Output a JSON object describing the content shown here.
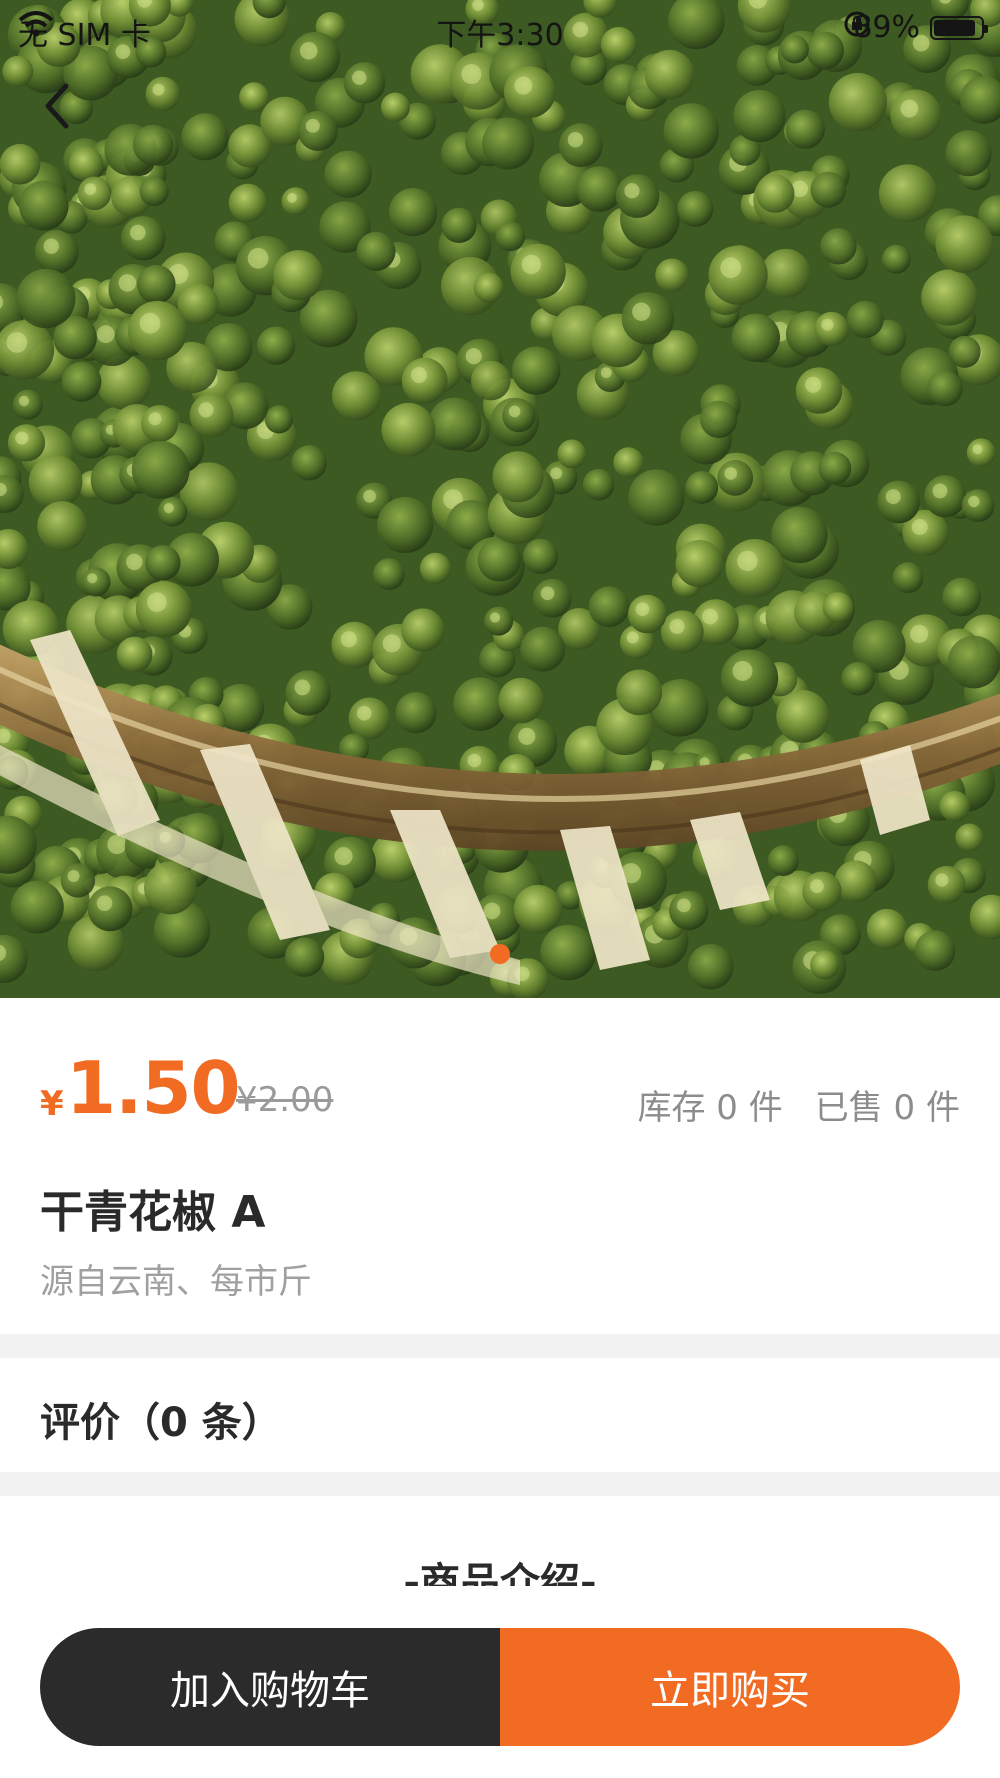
{
  "status_bar": {
    "carrier": "无 SIM 卡",
    "time": "下午3:30",
    "battery_percent_text": "89%",
    "battery_level": 0.89
  },
  "icons": {
    "wifi": "wifi-icon",
    "orientation_lock": "orientation-lock-icon",
    "battery": "battery-icon",
    "back": "chevron-left-icon"
  },
  "carousel": {
    "image": "product-photo-green-sichuan-pepper-basket",
    "slide_count": 1,
    "active_index": 0
  },
  "product": {
    "currency_symbol": "¥",
    "price": "1.50",
    "original_price": "¥2.00",
    "stock": "库存 0 件",
    "sold": "已售 0 件",
    "title": "干青花椒 A",
    "subtitle": "源自云南、每市斤"
  },
  "reviews": {
    "label": "评价（0 条）"
  },
  "intro": {
    "heading": "-商品介绍-"
  },
  "actions": {
    "add_to_cart": "加入购物车",
    "buy_now": "立即购买"
  },
  "colors": {
    "accent": "#f26b22",
    "dark_button": "#2b2b2b",
    "divider": "#f2f2f2",
    "muted_text": "#a0a0a0"
  }
}
